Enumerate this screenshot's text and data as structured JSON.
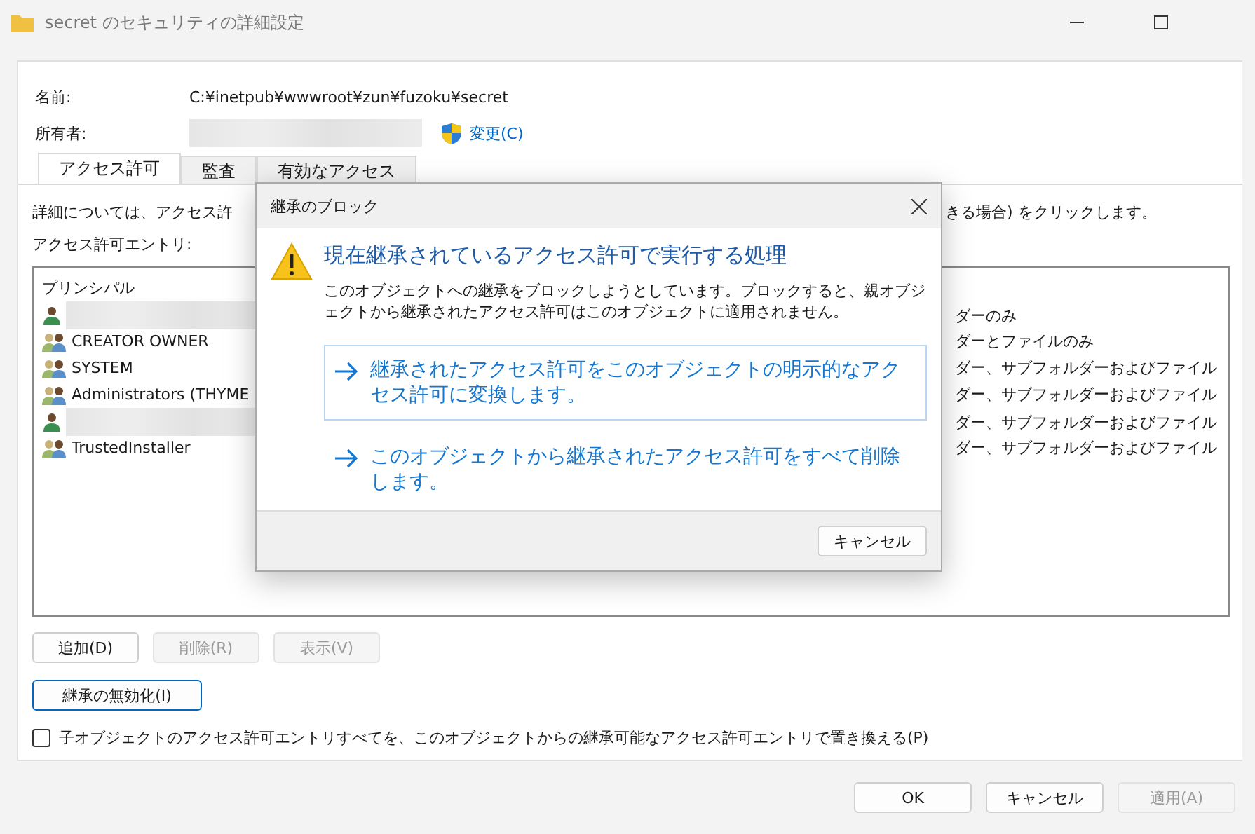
{
  "window": {
    "title": "secret のセキュリティの詳細設定"
  },
  "name_label": "名前:",
  "name_value": "C:¥inetpub¥wwwroot¥zun¥fuzoku¥secret",
  "owner_label": "所有者:",
  "owner_change": "変更(C)",
  "tabs": [
    {
      "label": "アクセス許可",
      "selected": true
    },
    {
      "label": "監査",
      "selected": false
    },
    {
      "label": "有効なアクセス",
      "selected": false
    }
  ],
  "info_left": "詳細については、アクセス許",
  "info_right": "きる場合) をクリックします。",
  "entries_label": "アクセス許可エントリ:",
  "entries": {
    "columns": [
      "プリンシパル"
    ],
    "rows": [
      {
        "kind": "user",
        "redacted": true,
        "applies_to": "ダーのみ"
      },
      {
        "kind": "group",
        "redacted": false,
        "principal": "CREATOR OWNER",
        "applies_to": "ダーとファイルのみ"
      },
      {
        "kind": "group",
        "redacted": false,
        "principal": "SYSTEM",
        "applies_to": "ダー、サブフォルダーおよびファイル"
      },
      {
        "kind": "group",
        "redacted": false,
        "principal": "Administrators (THYME",
        "applies_to": "ダー、サブフォルダーおよびファイル"
      },
      {
        "kind": "user",
        "redacted": true,
        "applies_to": "ダー、サブフォルダーおよびファイル"
      },
      {
        "kind": "group",
        "redacted": false,
        "principal": "TrustedInstaller",
        "applies_to": "ダー、サブフォルダーおよびファイル"
      }
    ]
  },
  "entry_buttons": [
    {
      "label": "追加(D)",
      "disabled": false
    },
    {
      "label": "削除(R)",
      "disabled": true
    },
    {
      "label": "表示(V)",
      "disabled": true
    }
  ],
  "disable_inheritance": "継承の無効化(I)",
  "replace_checkbox": {
    "label": "子オブジェクトのアクセス許可エントリすべてを、このオブジェクトからの継承可能なアクセス許可エントリで置き換える(P)",
    "checked": false
  },
  "footer_buttons": [
    {
      "label": "OK",
      "disabled": false
    },
    {
      "label": "キャンセル",
      "disabled": false
    },
    {
      "label": "適用(A)",
      "disabled": true
    }
  ],
  "dialog": {
    "title": "継承のブロック",
    "heading": "現在継承されているアクセス許可で実行する処理",
    "message": "このオブジェクトへの継承をブロックしようとしています。ブロックすると、親オブジェクトから継承されたアクセス許可はこのオブジェクトに適用されません。",
    "options": [
      {
        "label": "継承されたアクセス許可をこのオブジェクトの明示的なアクセス許可に変換します。",
        "selected": true
      },
      {
        "label": "このオブジェクトから継承されたアクセス許可をすべて削除します。",
        "selected": false
      }
    ],
    "cancel": "キャンセル"
  }
}
